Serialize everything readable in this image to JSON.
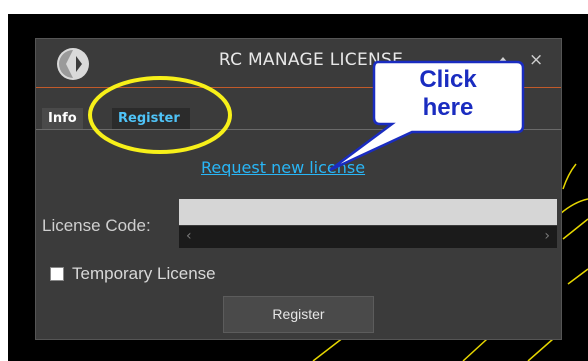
{
  "window": {
    "title": "RC MANAGE LICENSE",
    "collapse_icon": "chevron-up-icon",
    "close_glyph": "×"
  },
  "tabs": [
    {
      "label": "Info",
      "active": false
    },
    {
      "label": "Register",
      "active": true
    }
  ],
  "register": {
    "request_link": "Request new license",
    "license_code_label": "License Code:",
    "license_code_value": "",
    "scroll_left": "‹",
    "scroll_right": "›",
    "temporary_label": "Temporary License",
    "temporary_checked": false,
    "register_button": "Register"
  },
  "annotation": {
    "callout_text_line1": "Click",
    "callout_text_line2": "here",
    "highlight_color": "#f7f019",
    "callout_border_color": "#1a2cc0"
  },
  "colors": {
    "dialog_bg": "#3b3b3b",
    "accent": "#c25a2a",
    "link": "#29b6f6",
    "active_tab_text": "#4fc3f7"
  }
}
